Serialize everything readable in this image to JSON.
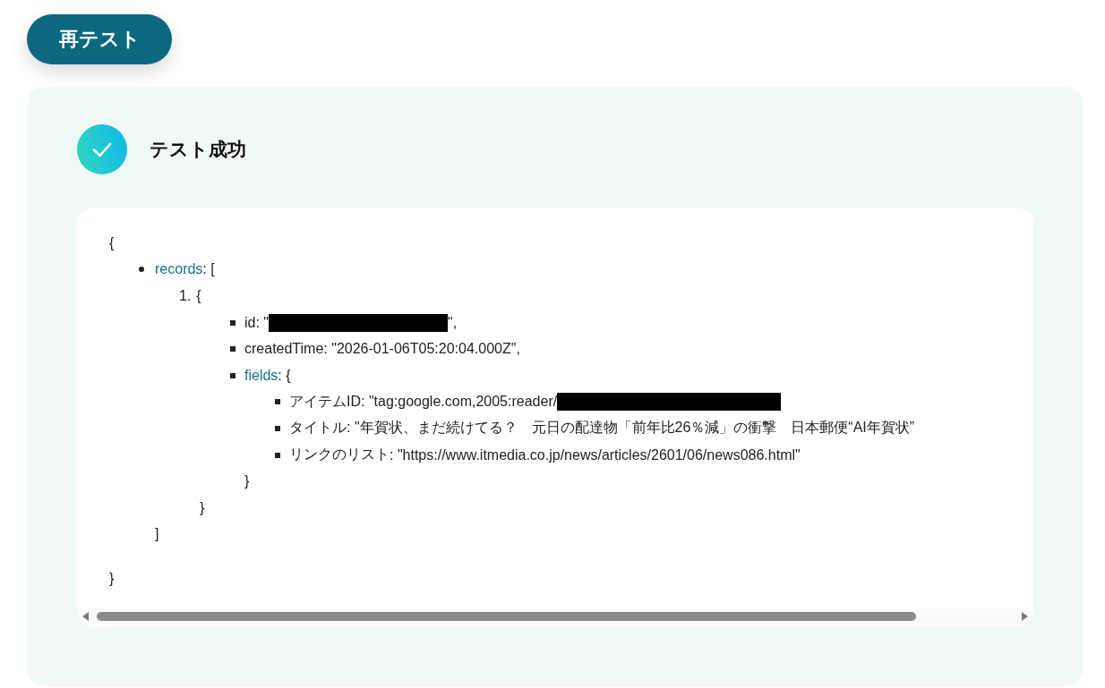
{
  "retest_button": "再テスト",
  "status": {
    "success": true,
    "label": "テスト成功"
  },
  "output": {
    "open": "{",
    "close": "}",
    "entries": [
      {
        "key": "records",
        "link": true,
        "text": ": [",
        "close": "]",
        "children": [
          {
            "number": "1.",
            "text": "{",
            "close": "}",
            "children": [
              {
                "key": "id",
                "link": false,
                "text": ": \"",
                "redacted": true,
                "after": "\","
              },
              {
                "key": "createdTime",
                "link": false,
                "text": ": \"2026-01-06T05:20:04.000Z\","
              },
              {
                "key": "fields",
                "link": true,
                "text": ": {",
                "close": "}",
                "children": [
                  {
                    "key": "アイテムID",
                    "link": false,
                    "text": ": \"tag:google.com,2005:reader/",
                    "redacted": true
                  },
                  {
                    "key": "タイトル",
                    "link": false,
                    "text": ": \"年賀状、まだ続けてる？　元日の配達物「前年比26％減」の衝撃　日本郵便“AI年賀状”"
                  },
                  {
                    "key": "リンクのリスト",
                    "link": false,
                    "text": ": \"https://www.itmedia.co.jp/news/articles/2601/06/news086.html\""
                  }
                ]
              }
            ]
          }
        ]
      }
    ]
  }
}
